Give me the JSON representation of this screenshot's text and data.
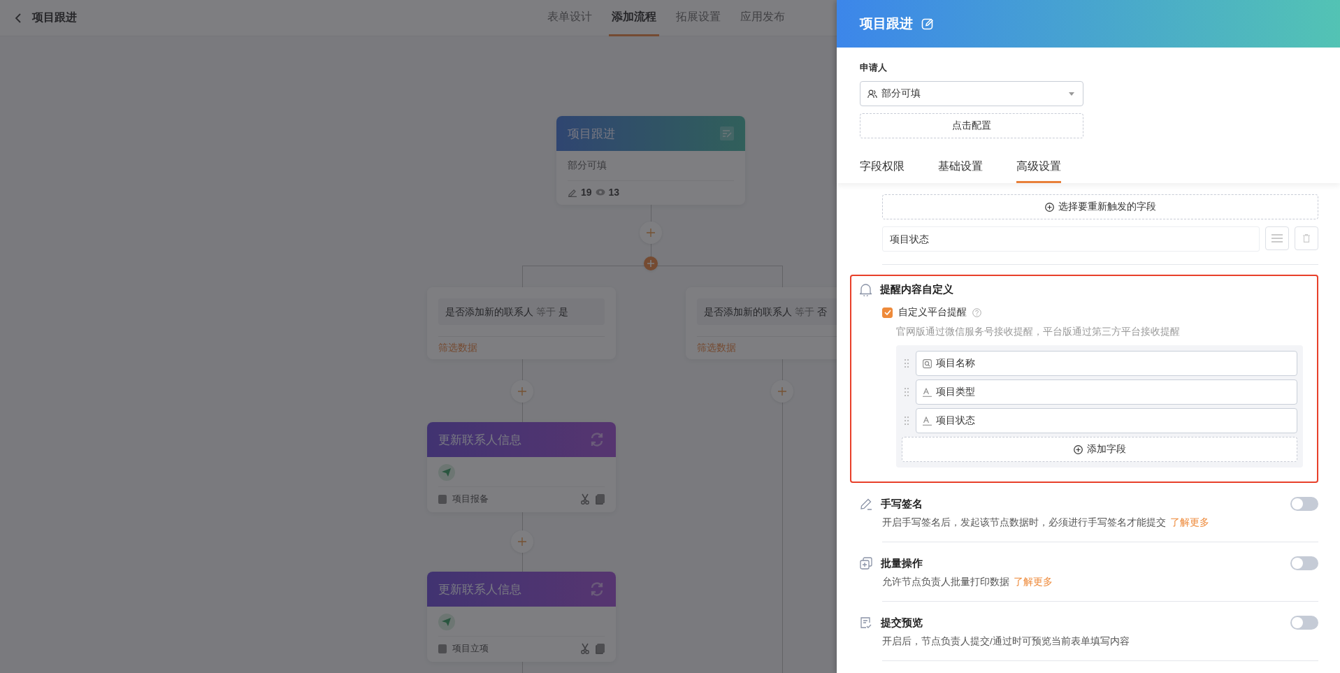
{
  "page": {
    "title": "项目跟进",
    "tabs": [
      {
        "label": "表单设计",
        "selected": false
      },
      {
        "label": "添加流程",
        "selected": true
      },
      {
        "label": "拓展设置",
        "selected": false
      },
      {
        "label": "应用发布",
        "selected": false
      }
    ]
  },
  "flow": {
    "start_node": {
      "title": "项目跟进",
      "subtitle": "部分可填",
      "edit_count": "19",
      "view_count": "13"
    },
    "branches": [
      {
        "field": "是否添加新的联系人",
        "operator": "等于",
        "value": "是",
        "action": "筛选数据"
      },
      {
        "field": "是否添加新的联系人",
        "operator": "等于",
        "value": "否",
        "action": "筛选数据"
      }
    ],
    "actions": [
      {
        "title": "更新联系人信息",
        "form": "项目报备"
      },
      {
        "title": "更新联系人信息",
        "form": "项目立项"
      }
    ]
  },
  "panel": {
    "title": "项目跟进",
    "applicant_label": "申请人",
    "select_value": "部分可填",
    "config_button": "点击配置",
    "tabs": [
      {
        "label": "字段权限",
        "selected": false
      },
      {
        "label": "基础设置",
        "selected": false
      },
      {
        "label": "高级设置",
        "selected": true
      }
    ],
    "retrigger_button": "选择要重新触发的字段",
    "retrigger_fields": [
      "项目状态"
    ],
    "reminder": {
      "title": "提醒内容自定义",
      "checkbox_label": "自定义平台提醒",
      "checked": true,
      "hint": "官网版通过微信服务号接收提醒，平台版通过第三方平台接收提醒",
      "fields": [
        {
          "label": "项目名称",
          "kind": "search"
        },
        {
          "label": "项目类型",
          "kind": "text"
        },
        {
          "label": "项目状态",
          "kind": "text"
        }
      ],
      "add_button": "添加字段"
    },
    "settings": [
      {
        "kind": "signature",
        "title": "手写签名",
        "description": "开启手写签名后，发起该节点数据时，必须进行手写签名才能提交",
        "link": "了解更多",
        "on": false
      },
      {
        "kind": "batch",
        "title": "批量操作",
        "description": "允许节点负责人批量打印数据",
        "link": "了解更多",
        "on": false
      },
      {
        "kind": "preview",
        "title": "提交预览",
        "description": "开启后，节点负责人提交/通过时可预览当前表单填写内容",
        "on": false
      }
    ]
  }
}
